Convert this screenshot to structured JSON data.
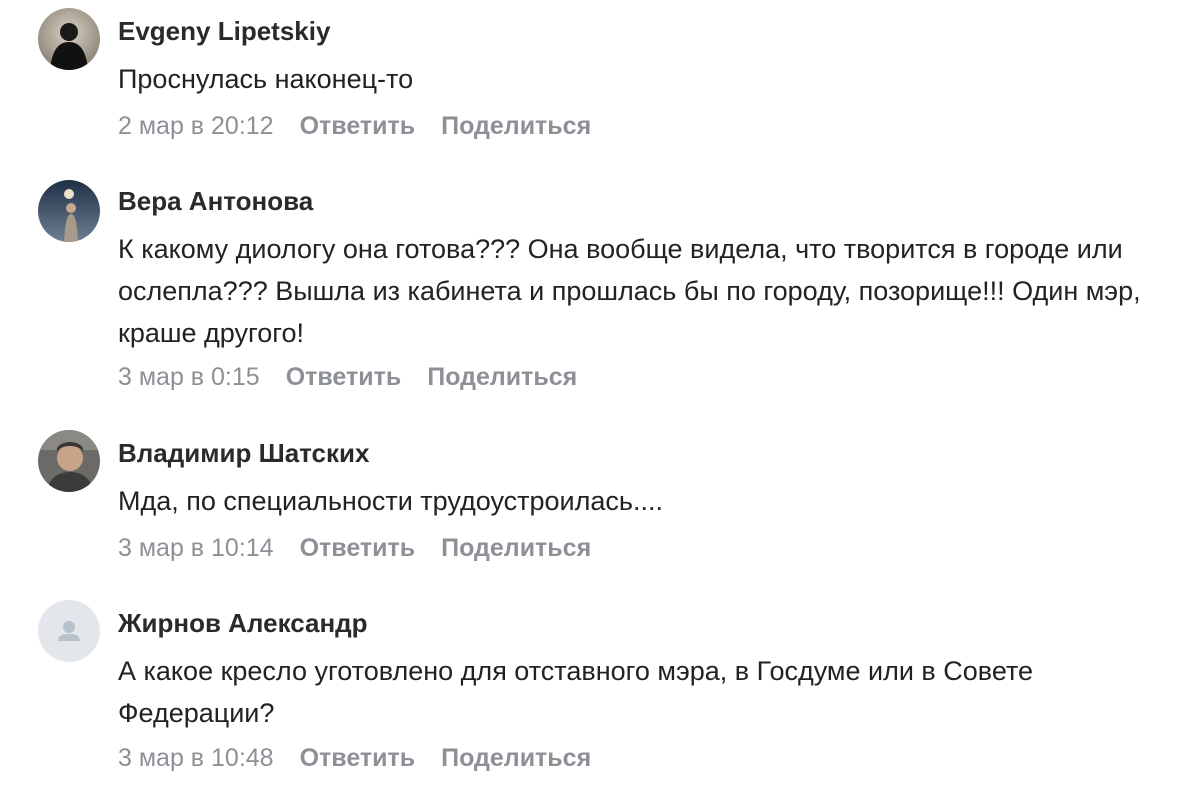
{
  "comments": [
    {
      "author": "Evgeny Lipetskiy",
      "avatar_icon": "user-photo-silhouette",
      "text": "Проснулась наконец-то",
      "date": "2 мар в 20:12",
      "reply_label": "Ответить",
      "share_label": "Поделиться"
    },
    {
      "author": "Вера Антонова",
      "avatar_icon": "user-photo",
      "text": "К какому диологу она готова??? Она вообще видела, что творится в городе или ослепла??? Вышла из кабинета и прошлась бы по городу, позорище!!! Один мэр, краше другого!",
      "date": "3 мар в 0:15",
      "reply_label": "Ответить",
      "share_label": "Поделиться"
    },
    {
      "author": "Владимир Шатских",
      "avatar_icon": "user-photo",
      "text": "Мда, по специальности трудоустроилась....",
      "date": "3 мар в 10:14",
      "reply_label": "Ответить",
      "share_label": "Поделиться"
    },
    {
      "author": "Жирнов Александр",
      "avatar_icon": "default-user-icon",
      "text": "А какое кресло уготовлено для отставного мэра, в Госдуме или в Совете Федерации?",
      "date": "3 мар в 10:48",
      "reply_label": "Ответить",
      "share_label": "Поделиться"
    }
  ]
}
